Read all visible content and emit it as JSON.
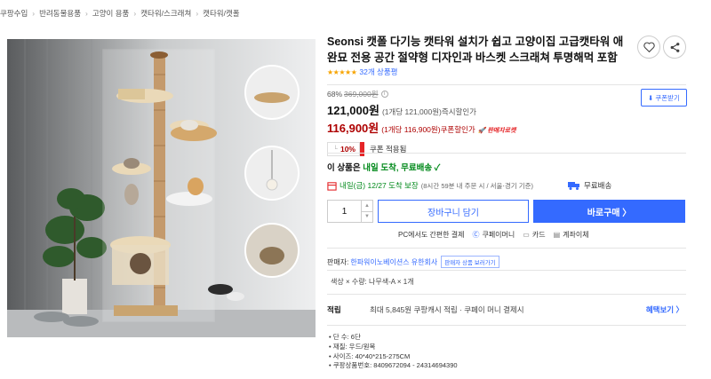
{
  "breadcrumb": [
    "쿠팡수입",
    "반려동물용품",
    "고양이 용품",
    "캣타워/스크래쳐",
    "캣타워/캣폴"
  ],
  "product": {
    "title": "Seonsi 캣폴 다기능 캣타워 설치가 쉽고 고양이집 고급캣타워 애완묘 전용 공간 절약형 디자인과 바스켓 스크래쳐 투명해먹 포함",
    "stars": "★★★★★",
    "rating_count": "32개 상품평"
  },
  "price": {
    "discount_rate": "68%",
    "original": "369,000원",
    "sale": "121,000원",
    "sale_unit": "(1개당 121,000원)",
    "sale_label": "즉시할인가",
    "coupon_price": "116,900원",
    "coupon_unit": "(1개당 116,900원)",
    "coupon_label": "쿠폰할인가",
    "rocket_badge": "판매자로켓",
    "coupon_button": "쿠폰받기",
    "coupon_rate": "10%",
    "coupon_applied": "쿠폰 적용됨"
  },
  "delivery": {
    "headline_prefix": "이 상품은",
    "headline_green": "내일 도착, 무료배송",
    "check": "✓",
    "date": "내일(금) 12/27 도착 보장",
    "note": "(8시간 59분 내 주문 시 / 서울⋅경기 기준)",
    "free": "무료배송"
  },
  "purchase": {
    "quantity": "1",
    "cart": "장바구니 담기",
    "buy": "바로구매 〉"
  },
  "payment": {
    "label": "PC에서도 간편한 결제",
    "options": [
      {
        "icon": "Ⓒ",
        "label": "쿠페이머니"
      },
      {
        "icon": "▭",
        "label": "카드"
      },
      {
        "icon": "▤",
        "label": "계좌이체"
      }
    ]
  },
  "seller": {
    "label": "판매자:",
    "name": "한파워이노베이션스 유한회사",
    "button": "판매자 상품 보러가기"
  },
  "option_text": "색상 × 수량: 나무색-A × 1개",
  "reward": {
    "label": "적립",
    "text": "최대 5,845원 쿠팡캐시 적립 · 쿠페이 머니 결제시",
    "more": "혜택보기 〉"
  },
  "specs": [
    "단 수: 6단",
    "재질: 우드/원목",
    "사이즈: 40*40*215-275CM",
    "쿠팡상품번호: 8409672094 - 24314694390"
  ],
  "colors": {
    "accent": "#346aff",
    "price_red": "#ae0000",
    "green": "#00891a",
    "star": "#f7a400"
  }
}
